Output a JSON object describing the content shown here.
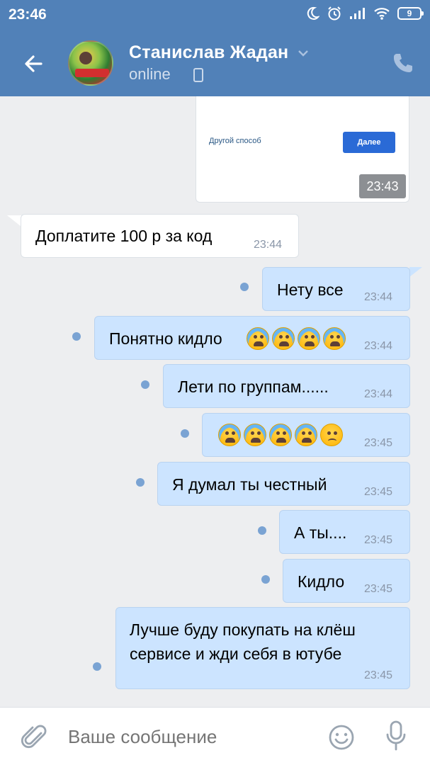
{
  "status_bar": {
    "time": "23:46",
    "battery": "9"
  },
  "header": {
    "contact_name": "Станислав Жадан",
    "status": "online"
  },
  "card": {
    "link": "Другой способ",
    "button": "Далее",
    "time": "23:43"
  },
  "messages": [
    {
      "dir": "in",
      "text": "Доплатите 100 р за код",
      "time": "23:44"
    },
    {
      "dir": "out",
      "text": "Нету все",
      "time": "23:44"
    },
    {
      "dir": "out",
      "text": "Понятно кидло",
      "emoji": [
        "loudly-crying-face",
        "loudly-crying-face",
        "loudly-crying-face",
        "loudly-crying-face"
      ],
      "time": "23:44"
    },
    {
      "dir": "out",
      "text": "Лети по группам......",
      "time": "23:44"
    },
    {
      "dir": "out",
      "text": "",
      "emoji": [
        "loudly-crying-face",
        "loudly-crying-face",
        "loudly-crying-face",
        "loudly-crying-face",
        "crying-face"
      ],
      "time": "23:45"
    },
    {
      "dir": "out",
      "text": "Я думал ты честный",
      "time": "23:45"
    },
    {
      "dir": "out",
      "text": "А ты....",
      "time": "23:45"
    },
    {
      "dir": "out",
      "text": "Кидло",
      "time": "23:45"
    },
    {
      "dir": "out",
      "text_lines": [
        "Лучше буду покупать на клёш",
        "сервисе и жди себя в ютубе"
      ],
      "time": "23:45"
    }
  ],
  "input": {
    "placeholder": "Ваше сообщение"
  },
  "colors": {
    "header": "#5181b8",
    "outgoing_bubble": "#cce4ff",
    "background": "#edeef0",
    "unread_dot": "#7aa3d3"
  }
}
